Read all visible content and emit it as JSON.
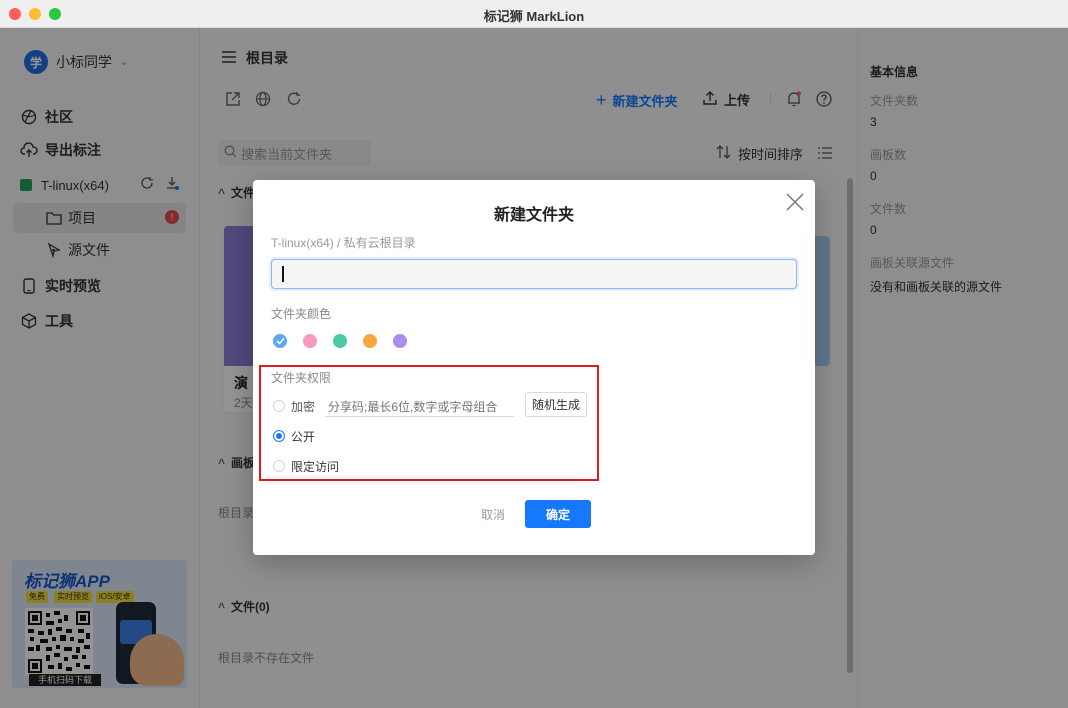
{
  "window": {
    "title": "标记狮 MarkLion"
  },
  "sidebar": {
    "user": {
      "avatar_text": "学",
      "name": "小标同学"
    },
    "nav": [
      {
        "label": "社区",
        "icon": "globe-icon"
      },
      {
        "label": "导出标注",
        "icon": "cloud-upload-icon"
      }
    ],
    "device": {
      "name": "T-linux(x64)",
      "color": "#20a35b"
    },
    "device_items": [
      {
        "label": "项目",
        "icon": "folder-icon"
      },
      {
        "label": "源文件",
        "icon": "source-file-icon"
      }
    ],
    "nav_bottom": [
      {
        "label": "实时预览",
        "icon": "phone-icon"
      },
      {
        "label": "工具",
        "icon": "cube-icon"
      }
    ],
    "promo": {
      "title": "标记狮APP",
      "tags": [
        "免费",
        "实时预览",
        "iOS/安卓"
      ],
      "qr_caption": "手机扫码下载"
    }
  },
  "main": {
    "header": "根目录",
    "new_folder": "新建文件夹",
    "upload": "上传",
    "search_placeholder": "搜索当前文件夹",
    "sort_label": "按时间排序",
    "sections": {
      "folders_partial": "文件",
      "card_title_partial": "演",
      "card_time_partial": "2天",
      "boards_partial": "画板",
      "boards_empty_partial": "根目录",
      "files": "文件(0)",
      "files_empty": "根目录不存在文件"
    }
  },
  "right_panel": {
    "title": "基本信息",
    "folder_count_label": "文件夹数",
    "folder_count": "3",
    "board_count_label": "画板数",
    "board_count": "0",
    "file_count_label": "文件数",
    "file_count": "0",
    "linked_label": "画板关联源文件",
    "linked_value": "没有和画板关联的源文件"
  },
  "dialog": {
    "title": "新建文件夹",
    "path": "T-linux(x64) / 私有云根目录",
    "name_value": "",
    "color_label": "文件夹颜色",
    "colors": [
      "#5ba8f5",
      "#f79ac0",
      "#4cc9a4",
      "#f7a83c",
      "#a78ef0"
    ],
    "selected_color_index": 0,
    "permission_label": "文件夹权限",
    "options": {
      "encrypt": "加密",
      "public": "公开",
      "restricted": "限定访问"
    },
    "selected_option": "public",
    "share_code_placeholder": "分享码;最长6位,数字或字母组合",
    "random_button": "随机生成",
    "cancel": "取消",
    "confirm": "确定",
    "accent": "#1677ff"
  }
}
